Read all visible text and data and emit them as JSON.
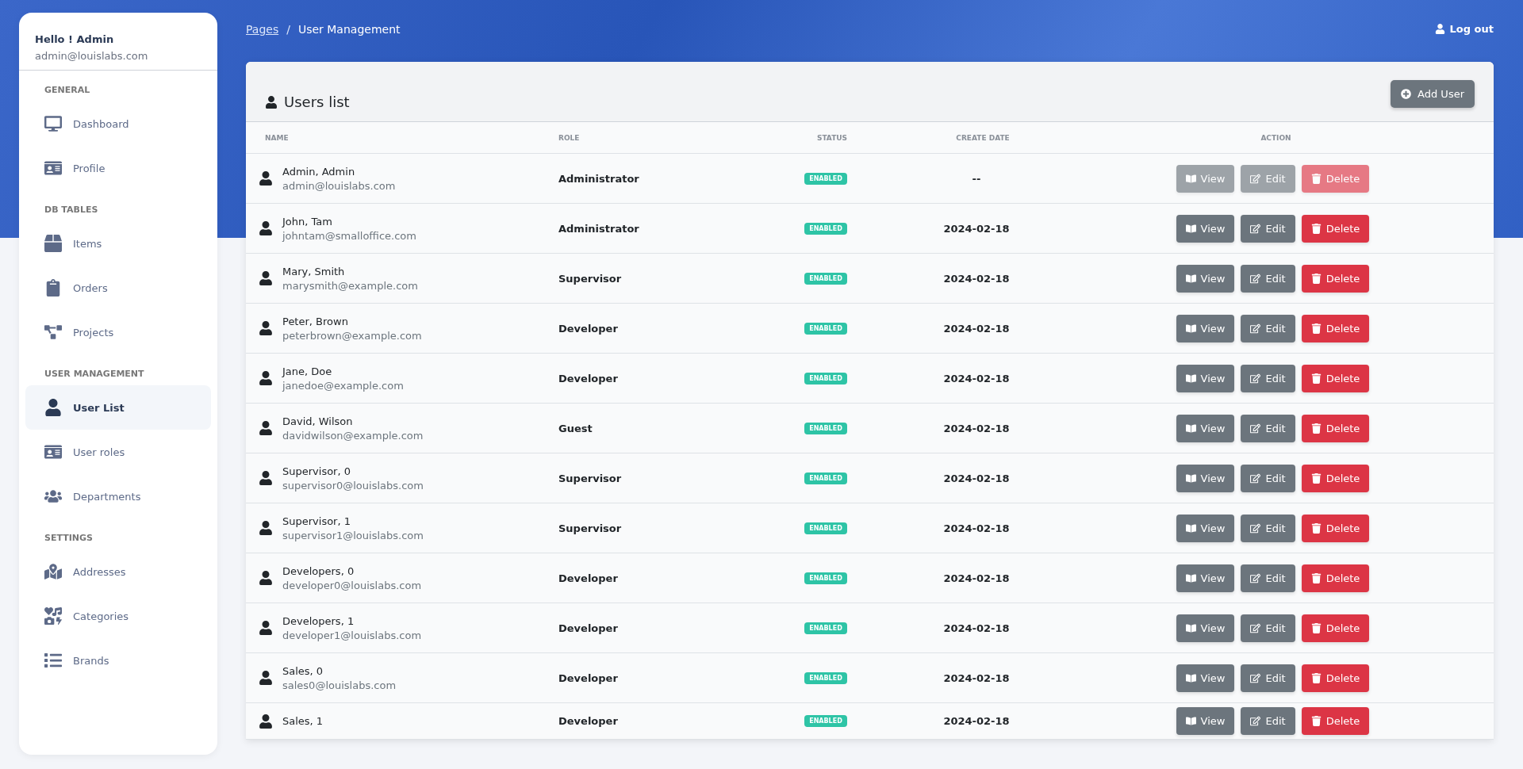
{
  "breadcrumb": {
    "parent": "Pages",
    "separator": "/",
    "current": "User Management"
  },
  "logout": "Log out",
  "sidebar": {
    "greeting": "Hello ! Admin",
    "email": "admin@louislabs.com",
    "sections": [
      {
        "title": "GENERAL",
        "items": [
          {
            "label": "Dashboard",
            "selected": false
          },
          {
            "label": "Profile",
            "selected": false
          }
        ]
      },
      {
        "title": "DB TABLES",
        "items": [
          {
            "label": "Items",
            "selected": false
          },
          {
            "label": "Orders",
            "selected": false
          },
          {
            "label": "Projects",
            "selected": false
          }
        ]
      },
      {
        "title": "USER MANAGEMENT",
        "items": [
          {
            "label": "User List",
            "selected": true
          },
          {
            "label": "User roles",
            "selected": false
          },
          {
            "label": "Departments",
            "selected": false
          }
        ]
      },
      {
        "title": "SETTINGS",
        "items": [
          {
            "label": "Addresses",
            "selected": false
          },
          {
            "label": "Categories",
            "selected": false
          },
          {
            "label": "Brands",
            "selected": false
          }
        ]
      }
    ]
  },
  "card": {
    "title": "Users list",
    "add_button": "Add User"
  },
  "table": {
    "columns": [
      "NAME",
      "ROLE",
      "STATUS",
      "CREATE DATE",
      "ACTION"
    ],
    "rows": [
      {
        "name": "Admin, Admin",
        "email": "admin@louislabs.com",
        "role": "Administrator",
        "status": "ENABLED",
        "date": "--",
        "disabled": true,
        "actions": [
          "View",
          "Edit",
          "Delete"
        ]
      },
      {
        "name": "John, Tam",
        "email": "johntam@smalloffice.com",
        "role": "Administrator",
        "status": "ENABLED",
        "date": "2024-02-18",
        "disabled": false,
        "actions": [
          "View",
          "Edit",
          "Delete"
        ]
      },
      {
        "name": "Mary, Smith",
        "email": "marysmith@example.com",
        "role": "Supervisor",
        "status": "ENABLED",
        "date": "2024-02-18",
        "disabled": false,
        "actions": [
          "View",
          "Edit",
          "Delete"
        ]
      },
      {
        "name": "Peter, Brown",
        "email": "peterbrown@example.com",
        "role": "Developer",
        "status": "ENABLED",
        "date": "2024-02-18",
        "disabled": false,
        "actions": [
          "View",
          "Edit",
          "Delete"
        ]
      },
      {
        "name": "Jane, Doe",
        "email": "janedoe@example.com",
        "role": "Developer",
        "status": "ENABLED",
        "date": "2024-02-18",
        "disabled": false,
        "actions": [
          "View",
          "Edit",
          "Delete"
        ]
      },
      {
        "name": "David, Wilson",
        "email": "davidwilson@example.com",
        "role": "Guest",
        "status": "ENABLED",
        "date": "2024-02-18",
        "disabled": false,
        "actions": [
          "View",
          "Edit",
          "Delete"
        ]
      },
      {
        "name": "Supervisor, 0",
        "email": "supervisor0@louislabs.com",
        "role": "Supervisor",
        "status": "ENABLED",
        "date": "2024-02-18",
        "disabled": false,
        "actions": [
          "View",
          "Edit",
          "Delete"
        ]
      },
      {
        "name": "Supervisor, 1",
        "email": "supervisor1@louislabs.com",
        "role": "Supervisor",
        "status": "ENABLED",
        "date": "2024-02-18",
        "disabled": false,
        "actions": [
          "View",
          "Edit",
          "Delete"
        ]
      },
      {
        "name": "Developers, 0",
        "email": "developer0@louislabs.com",
        "role": "Developer",
        "status": "ENABLED",
        "date": "2024-02-18",
        "disabled": false,
        "actions": [
          "View",
          "Edit",
          "Delete"
        ]
      },
      {
        "name": "Developers, 1",
        "email": "developer1@louislabs.com",
        "role": "Developer",
        "status": "ENABLED",
        "date": "2024-02-18",
        "disabled": false,
        "actions": [
          "View",
          "Edit",
          "Delete"
        ]
      },
      {
        "name": "Sales, 0",
        "email": "sales0@louislabs.com",
        "role": "Developer",
        "status": "ENABLED",
        "date": "2024-02-18",
        "disabled": false,
        "actions": [
          "View",
          "Edit",
          "Delete"
        ]
      },
      {
        "name": "Sales, 1",
        "role": "Developer",
        "status": "ENABLED",
        "date": "2024-02-18",
        "disabled": false,
        "actions": [
          "View",
          "Edit",
          "Delete"
        ]
      }
    ]
  }
}
